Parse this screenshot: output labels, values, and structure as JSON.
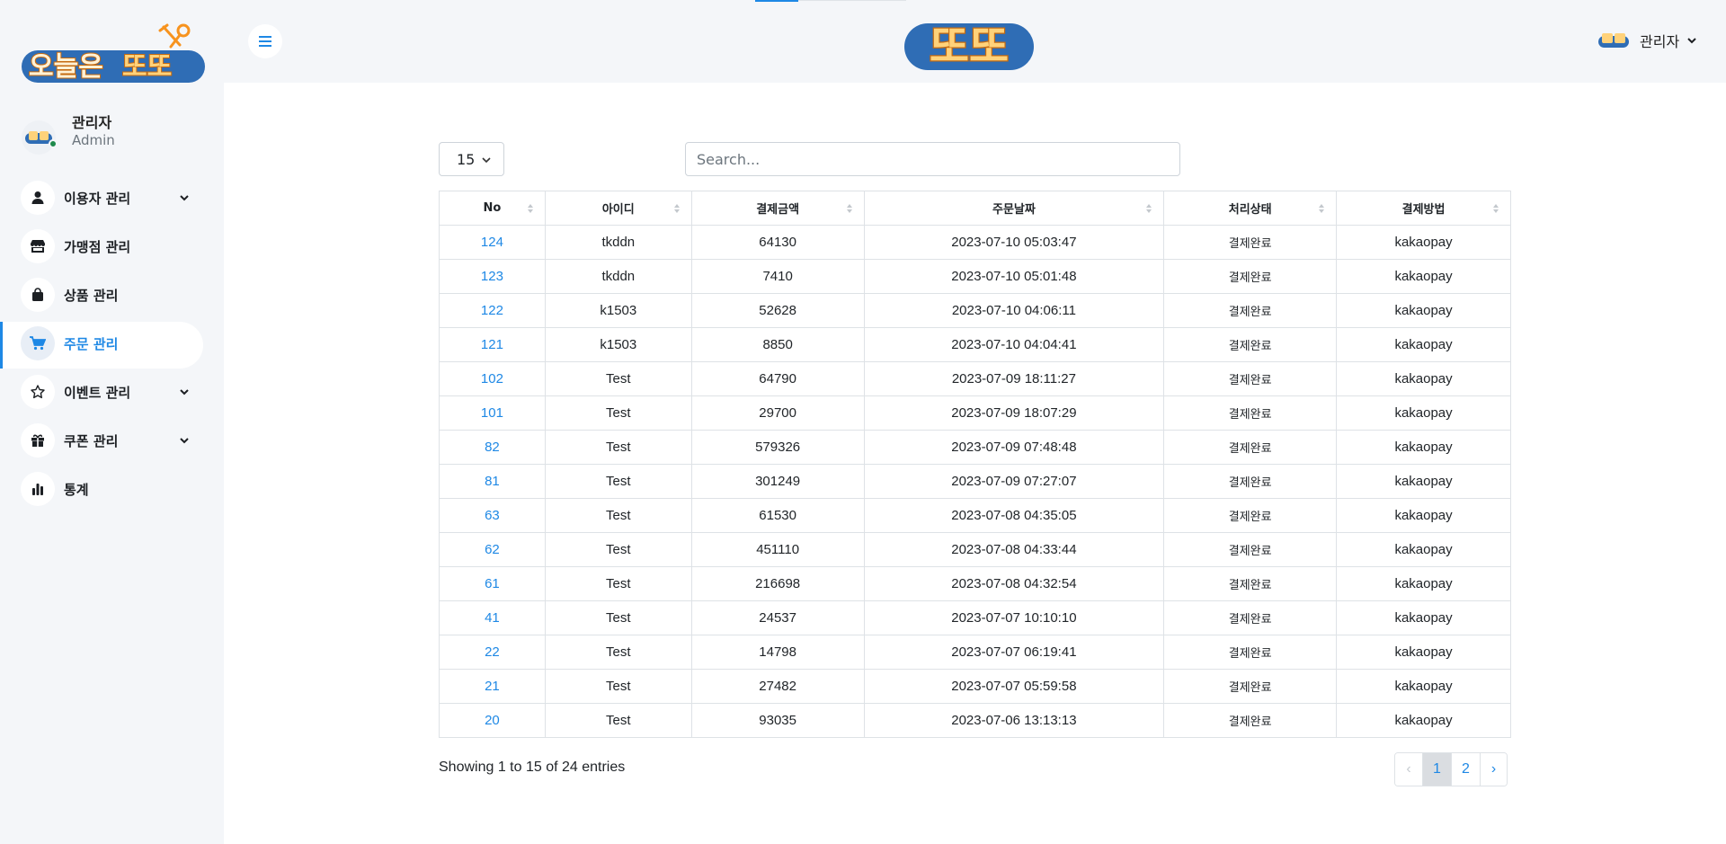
{
  "brand": {
    "sidebar_logo_name": "오늘은 또또",
    "header_logo_name": "또또"
  },
  "profile": {
    "name": "관리자",
    "role": "Admin"
  },
  "sidebar": {
    "items": [
      {
        "label": "이용자 관리",
        "icon": "person-icon",
        "has_submenu": true,
        "active": false
      },
      {
        "label": "가맹점 관리",
        "icon": "store-icon",
        "has_submenu": false,
        "active": false
      },
      {
        "label": "상품 관리",
        "icon": "shopping-bag-icon",
        "has_submenu": false,
        "active": false
      },
      {
        "label": "주문 관리",
        "icon": "cart-icon",
        "has_submenu": false,
        "active": true
      },
      {
        "label": "이벤트 관리",
        "icon": "star-icon",
        "has_submenu": true,
        "active": false
      },
      {
        "label": "쿠폰 관리",
        "icon": "gift-icon",
        "has_submenu": true,
        "active": false
      },
      {
        "label": "통계",
        "icon": "bar-chart-icon",
        "has_submenu": false,
        "active": false
      }
    ]
  },
  "header": {
    "user_name": "관리자"
  },
  "controls": {
    "page_length": "15",
    "search_placeholder": "Search..."
  },
  "table": {
    "columns": [
      "No",
      "아이디",
      "결제금액",
      "주문날짜",
      "처리상태",
      "결제방법"
    ],
    "rows": [
      [
        "124",
        "tkddn",
        "64130",
        "2023-07-10 05:03:47",
        "결제완료",
        "kakaopay"
      ],
      [
        "123",
        "tkddn",
        "7410",
        "2023-07-10 05:01:48",
        "결제완료",
        "kakaopay"
      ],
      [
        "122",
        "k1503",
        "52628",
        "2023-07-10 04:06:11",
        "결제완료",
        "kakaopay"
      ],
      [
        "121",
        "k1503",
        "8850",
        "2023-07-10 04:04:41",
        "결제완료",
        "kakaopay"
      ],
      [
        "102",
        "Test",
        "64790",
        "2023-07-09 18:11:27",
        "결제완료",
        "kakaopay"
      ],
      [
        "101",
        "Test",
        "29700",
        "2023-07-09 18:07:29",
        "결제완료",
        "kakaopay"
      ],
      [
        "82",
        "Test",
        "579326",
        "2023-07-09 07:48:48",
        "결제완료",
        "kakaopay"
      ],
      [
        "81",
        "Test",
        "301249",
        "2023-07-09 07:27:07",
        "결제완료",
        "kakaopay"
      ],
      [
        "63",
        "Test",
        "61530",
        "2023-07-08 04:35:05",
        "결제완료",
        "kakaopay"
      ],
      [
        "62",
        "Test",
        "451110",
        "2023-07-08 04:33:44",
        "결제완료",
        "kakaopay"
      ],
      [
        "61",
        "Test",
        "216698",
        "2023-07-08 04:32:54",
        "결제완료",
        "kakaopay"
      ],
      [
        "41",
        "Test",
        "24537",
        "2023-07-07 10:10:10",
        "결제완료",
        "kakaopay"
      ],
      [
        "22",
        "Test",
        "14798",
        "2023-07-07 06:19:41",
        "결제완료",
        "kakaopay"
      ],
      [
        "21",
        "Test",
        "27482",
        "2023-07-07 05:59:58",
        "결제완료",
        "kakaopay"
      ],
      [
        "20",
        "Test",
        "93035",
        "2023-07-06 13:13:13",
        "결제완료",
        "kakaopay"
      ]
    ]
  },
  "footer": {
    "info": "Showing 1 to 15 of 24 entries",
    "pagination": {
      "prev": "‹",
      "pages": [
        "1",
        "2"
      ],
      "current": "1",
      "next": "›"
    }
  },
  "colors": {
    "accent": "#1e88e5",
    "sidebar_bg": "#f4f6f9",
    "online_dot": "#1e8a4c",
    "logo_orange": "#f7931e",
    "logo_blue": "#2f6db5"
  }
}
